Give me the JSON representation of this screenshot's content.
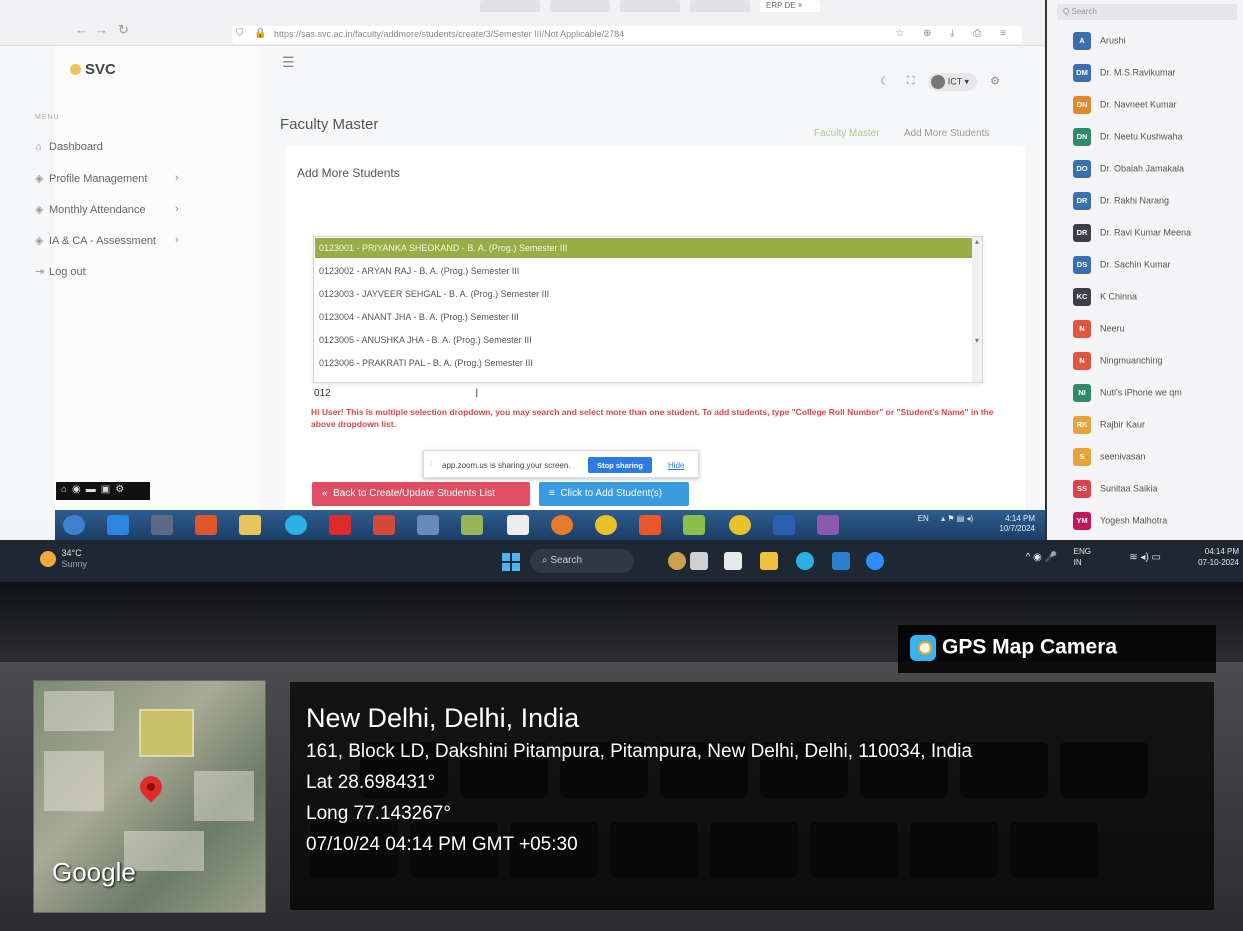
{
  "browser": {
    "url": "https://sas.svc.ac.in/faculty/addmore/students/create/3/Semester III/Not Applicable/2784",
    "active_tab": "ERP DE ×"
  },
  "app": {
    "brand": "SVC",
    "menu_caption": "MENU",
    "menu": [
      {
        "label": "Dashboard",
        "icon": "home-icon",
        "has_submenu": false
      },
      {
        "label": "Profile Management",
        "icon": "layers-icon",
        "has_submenu": true
      },
      {
        "label": "Monthly Attendance",
        "icon": "layers-icon",
        "has_submenu": true
      },
      {
        "label": "IA & CA - Assessment",
        "icon": "layers-icon",
        "has_submenu": true
      },
      {
        "label": "Log out",
        "icon": "logout-icon",
        "has_submenu": false
      }
    ],
    "user": "ICT",
    "page_title": "Faculty Master",
    "breadcrumb": [
      "Faculty Master",
      "Add More Students"
    ],
    "card_title": "Add More Students",
    "dropdown_options": [
      "0123001 - PRIYANKA SHEOKAND - B. A. (Prog.) Semester III",
      "0123002 - ARYAN RAJ - B. A. (Prog.) Semester III",
      "0123003 - JAYVEER SEHGAL - B. A. (Prog.) Semester III",
      "0123004 - ANANT JHA - B. A. (Prog.) Semester III",
      "0123005 - ANUSHKA JHA - B. A. (Prog.) Semester III",
      "0123006 - PRAKRATI PAL - B. A. (Prog.) Semester III"
    ],
    "selected_index": 0,
    "search_value": "012",
    "hint": "Hi User! This is multiple selection dropdown, you may search and select more than one student. To add students, type \"College Roll Number\" or \"Student's Name\" in the above dropdown list.",
    "back_button": "Back to Create/Update Students List",
    "add_button": "Click to Add Student(s)",
    "colors": {
      "selected_option": "#98ad45",
      "back_button": "#e04e63",
      "add_button": "#3b9be0",
      "hint": "#e0464a"
    }
  },
  "zoom_share": {
    "text": "app.zoom.us is sharing your screen.",
    "stop": "Stop sharing",
    "hide": "Hide"
  },
  "inner_tray": {
    "lang": "EN",
    "time": "4:14 PM",
    "date": "10/7/2024"
  },
  "participants": {
    "search_placeholder": "Q Search",
    "people": [
      {
        "initials": "A",
        "name": "Arushi",
        "color": "#3a6fb0"
      },
      {
        "initials": "DM",
        "name": "Dr. M.S.Ravikumar",
        "color": "#3a6fb0"
      },
      {
        "initials": "DN",
        "name": "Dr. Navneet Kumar",
        "color": "#e08a2c"
      },
      {
        "initials": "DN",
        "name": "Dr. Neetu Kushwaha",
        "color": "#2e8b6a"
      },
      {
        "initials": "DO",
        "name": "Dr. Obaiah Jamakala",
        "color": "#3a6fb0"
      },
      {
        "initials": "DR",
        "name": "Dr. Rakhi Narang",
        "color": "#3a6fb0"
      },
      {
        "initials": "DR",
        "name": "Dr. Ravi Kumar Meena",
        "color": "#3b3f46"
      },
      {
        "initials": "DS",
        "name": "Dr. Sachin Kumar",
        "color": "#3a6fb0"
      },
      {
        "initials": "KC",
        "name": "K Chinna",
        "color": "#3b3f46"
      },
      {
        "initials": "N",
        "name": "Neeru",
        "color": "#e0573e"
      },
      {
        "initials": "N",
        "name": "Ningmuanching",
        "color": "#e0573e"
      },
      {
        "initials": "NI",
        "name": "Nuti's iPhone we qm",
        "color": "#2e8b6a"
      },
      {
        "initials": "RK",
        "name": "Rajbir Kaur",
        "color": "#e8a23c"
      },
      {
        "initials": "S",
        "name": "seenivasan",
        "color": "#e8a23c"
      },
      {
        "initials": "SS",
        "name": "Sunitaa Saikia",
        "color": "#d9434a"
      },
      {
        "initials": "YM",
        "name": "Yogesh Malhotra",
        "color": "#c2185b"
      }
    ]
  },
  "win_taskbar": {
    "weather_temp": "34°C",
    "weather_desc": "Sunny",
    "search": "Search",
    "lang": "ENG",
    "region": "IN",
    "time": "04:14 PM",
    "date": "07-10-2024"
  },
  "gps": {
    "app_name": "GPS Map Camera",
    "map_brand": "Google",
    "city": "New Delhi, Delhi, India",
    "address": "161, Block LD, Dakshini Pitampura, Pitampura, New Delhi, Delhi, 110034, India",
    "lat": "Lat 28.698431°",
    "long": "Long 77.143267°",
    "datetime": "07/10/24 04:14 PM GMT +05:30"
  }
}
